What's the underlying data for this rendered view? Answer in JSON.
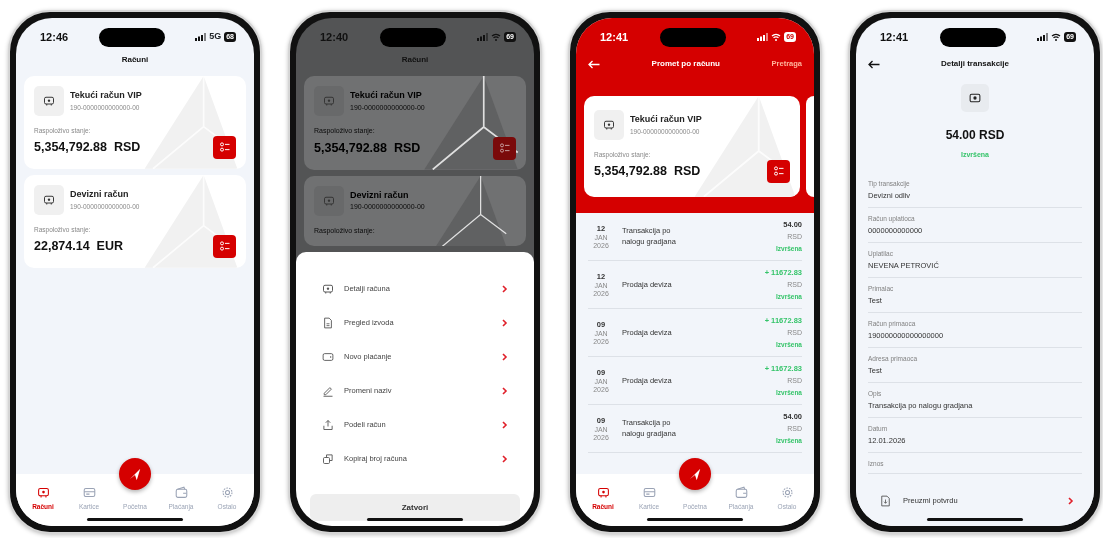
{
  "phones": [
    {
      "kind": "accounts",
      "status": {
        "time": "12:46",
        "network": "5G",
        "battery": "68"
      },
      "title": "Računi",
      "accounts": [
        {
          "name": "Tekući račun VIP",
          "number": "190-0000000000000-00",
          "balance_label": "Raspoloživo stanje:",
          "balance": "5,354,792.88  RSD"
        },
        {
          "name": "Devizni račun",
          "number": "190-0000000000000-00",
          "balance_label": "Raspoloživo stanje:",
          "balance": "22,874.14  EUR"
        }
      ],
      "tabbar": [
        {
          "label": "Računi",
          "selected": true
        },
        {
          "label": "Kartice",
          "selected": false
        },
        {
          "label": "Početna",
          "selected": false
        },
        {
          "label": "Plaćanja",
          "selected": false
        },
        {
          "label": "Ostalo",
          "selected": false
        }
      ]
    },
    {
      "kind": "sheet",
      "status": {
        "time": "12:40",
        "battery": "69"
      },
      "title": "Računi",
      "accounts": [
        {
          "name": "Tekući račun VIP",
          "number": "190-0000000000000-00",
          "balance_label": "Raspoloživo stanje:",
          "balance": "5,354,792.88  RSD"
        },
        {
          "name": "Devizni račun",
          "number": "190-0000000000000-00",
          "balance_label": "Raspoloživo stanje:"
        }
      ],
      "menu": [
        "Detalji računa",
        "Pregled izvoda",
        "Novo plaćanje",
        "Promeni naziv",
        "Podeli račun",
        "Kopiraj broj računa"
      ],
      "close": "Zatvori"
    },
    {
      "kind": "history",
      "status": {
        "time": "12:41",
        "battery": "69"
      },
      "title": "Promet po računu",
      "action": "Pretraga",
      "account": {
        "name": "Tekući račun VIP",
        "number": "190-0000000000000-00",
        "balance_label": "Raspoloživo stanje:",
        "balance": "5,354,792.88  RSD"
      },
      "transactions": [
        {
          "day": "12",
          "month": "JAN",
          "year": "2026",
          "title": "Transakcija po nalogu gradjana",
          "amount": "54.00",
          "currency": "RSD",
          "status": "Izvršena",
          "incoming": false
        },
        {
          "day": "12",
          "month": "JAN",
          "year": "2026",
          "title": "Prodaja deviza",
          "amount": "+ 11672.83",
          "currency": "RSD",
          "status": "Izvršena",
          "incoming": true
        },
        {
          "day": "09",
          "month": "JAN",
          "year": "2026",
          "title": "Prodaja deviza",
          "amount": "+ 11672.83",
          "currency": "RSD",
          "status": "Izvršena",
          "incoming": true
        },
        {
          "day": "09",
          "month": "JAN",
          "year": "2026",
          "title": "Prodaja deviza",
          "amount": "+ 11672.83",
          "currency": "RSD",
          "status": "Izvršena",
          "incoming": true
        },
        {
          "day": "09",
          "month": "JAN",
          "year": "2026",
          "title": "Transakcija po nalogu gradjana",
          "amount": "54.00",
          "currency": "RSD",
          "status": "Izvršena",
          "incoming": false
        }
      ],
      "tabbar": [
        {
          "label": "Računi",
          "selected": true
        },
        {
          "label": "Kartice",
          "selected": false
        },
        {
          "label": "Početna",
          "selected": false
        },
        {
          "label": "Plaćanja",
          "selected": false
        },
        {
          "label": "Ostalo",
          "selected": false
        }
      ]
    },
    {
      "kind": "detail",
      "status": {
        "time": "12:41",
        "battery": "69"
      },
      "title": "Detalji transakcije",
      "amount": "54.00 RSD",
      "state": "Izvršena",
      "fields": [
        {
          "label": "Tip transakcije",
          "value": "Devizni odliv"
        },
        {
          "label": "Račun uplatioca",
          "value": "0000000000000"
        },
        {
          "label": "Uplatilac",
          "value": "NEVENA PETROVIĆ"
        },
        {
          "label": "Primalac",
          "value": "Test"
        },
        {
          "label": "Račun primaoca",
          "value": "190000000000000000"
        },
        {
          "label": "Adresa primaoca",
          "value": "Test"
        },
        {
          "label": "Opis",
          "value": "Transakcija po nalogu gradjana"
        },
        {
          "label": "Datum",
          "value": "12.01.2026"
        },
        {
          "label": "Iznos"
        }
      ],
      "download": "Preuzmi potvrdu"
    }
  ]
}
